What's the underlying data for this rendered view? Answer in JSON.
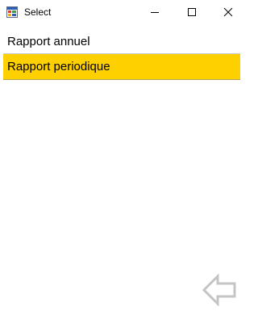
{
  "window": {
    "title": "Select"
  },
  "titlebar": {
    "icons": [
      "app-icon",
      "minimize-icon",
      "maximize-icon",
      "close-icon"
    ]
  },
  "list": {
    "items": [
      {
        "label": "Rapport annuel",
        "selected": false
      },
      {
        "label": "Rapport periodique",
        "selected": true
      }
    ],
    "selected_color": "#ffd000"
  },
  "footer": {
    "back_icon": "back-arrow-icon"
  }
}
